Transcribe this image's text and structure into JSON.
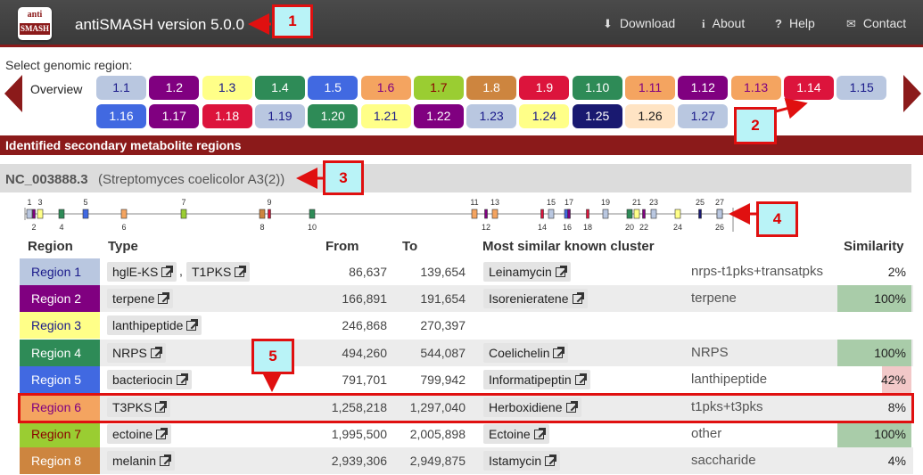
{
  "header": {
    "logo_top": "anti",
    "logo_bottom": "SMASH",
    "title": "antiSMASH version 5.0.0",
    "nav": [
      {
        "label": "Download",
        "icon": "download-icon",
        "glyph": "⬇"
      },
      {
        "label": "About",
        "icon": "info-icon",
        "glyph": "i"
      },
      {
        "label": "Help",
        "icon": "help-icon",
        "glyph": "?"
      },
      {
        "label": "Contact",
        "icon": "mail-icon",
        "glyph": "✉"
      }
    ]
  },
  "callouts": [
    "1",
    "2",
    "3",
    "4",
    "5"
  ],
  "selector": {
    "label": "Select genomic region:",
    "overview": "Overview",
    "regions": [
      {
        "label": "1.1",
        "bg": "#b9c7e0",
        "fg": "#1a1a8a"
      },
      {
        "label": "1.2",
        "bg": "#800080",
        "fg": "#ffffff"
      },
      {
        "label": "1.3",
        "bg": "#ffff88",
        "fg": "#1a1a8a"
      },
      {
        "label": "1.4",
        "bg": "#2e8b57",
        "fg": "#ffffff"
      },
      {
        "label": "1.5",
        "bg": "#4169e1",
        "fg": "#ffffff"
      },
      {
        "label": "1.6",
        "bg": "#f4a460",
        "fg": "#800080"
      },
      {
        "label": "1.7",
        "bg": "#9acd32",
        "fg": "#8b0000"
      },
      {
        "label": "1.8",
        "bg": "#cd853f",
        "fg": "#ffffff"
      },
      {
        "label": "1.9",
        "bg": "#dc143c",
        "fg": "#ffffff"
      },
      {
        "label": "1.10",
        "bg": "#2e8b57",
        "fg": "#ffffff"
      },
      {
        "label": "1.11",
        "bg": "#f4a460",
        "fg": "#800080"
      },
      {
        "label": "1.12",
        "bg": "#800080",
        "fg": "#ffffff"
      },
      {
        "label": "1.13",
        "bg": "#f4a460",
        "fg": "#800080"
      },
      {
        "label": "1.14",
        "bg": "#dc143c",
        "fg": "#ffffff"
      },
      {
        "label": "1.15",
        "bg": "#b9c7e0",
        "fg": "#1a1a8a"
      },
      {
        "label": "1.16",
        "bg": "#4169e1",
        "fg": "#ffffff"
      },
      {
        "label": "1.17",
        "bg": "#800080",
        "fg": "#ffffff"
      },
      {
        "label": "1.18",
        "bg": "#dc143c",
        "fg": "#ffffff"
      },
      {
        "label": "1.19",
        "bg": "#b9c7e0",
        "fg": "#1a1a8a"
      },
      {
        "label": "1.20",
        "bg": "#2e8b57",
        "fg": "#ffffff"
      },
      {
        "label": "1.21",
        "bg": "#ffff88",
        "fg": "#1a1a8a"
      },
      {
        "label": "1.22",
        "bg": "#800080",
        "fg": "#ffffff"
      },
      {
        "label": "1.23",
        "bg": "#b9c7e0",
        "fg": "#1a1a8a"
      },
      {
        "label": "1.24",
        "bg": "#ffff88",
        "fg": "#1a1a8a"
      },
      {
        "label": "1.25",
        "bg": "#191970",
        "fg": "#ffffff"
      },
      {
        "label": "1.26",
        "bg": "#ffe4c4",
        "fg": "#1a1a1a"
      },
      {
        "label": "1.27",
        "bg": "#b9c7e0",
        "fg": "#1a1a8a"
      }
    ]
  },
  "section": {
    "title": "Identified secondary metabolite regions"
  },
  "record": {
    "id": "NC_003888.3",
    "description": "(Streptomyces coelicolor A3(2))"
  },
  "genome": {
    "markers": [
      {
        "n": "1",
        "above": true,
        "fill": "#b9c7e0"
      },
      {
        "n": "2",
        "above": false,
        "fill": "#800080"
      },
      {
        "n": "3",
        "above": true,
        "fill": "#ffff88"
      },
      {
        "n": "4",
        "above": false,
        "fill": "#2e8b57"
      },
      {
        "n": "5",
        "above": true,
        "fill": "#4169e1"
      },
      {
        "n": "6",
        "above": false,
        "fill": "#f4a460"
      },
      {
        "n": "7",
        "above": true,
        "fill": "#9acd32"
      },
      {
        "n": "8",
        "above": false,
        "fill": "#cd853f"
      },
      {
        "n": "9",
        "above": true,
        "fill": "#dc143c"
      },
      {
        "n": "10",
        "above": false,
        "fill": "#2e8b57"
      },
      {
        "n": "11",
        "above": true,
        "fill": "#f4a460"
      },
      {
        "n": "12",
        "above": false,
        "fill": "#800080"
      },
      {
        "n": "13",
        "above": true,
        "fill": "#f4a460"
      },
      {
        "n": "14",
        "above": false,
        "fill": "#dc143c"
      },
      {
        "n": "15",
        "above": true,
        "fill": "#b9c7e0"
      },
      {
        "n": "16",
        "above": false,
        "fill": "#4169e1"
      },
      {
        "n": "17",
        "above": true,
        "fill": "#800080"
      },
      {
        "n": "18",
        "above": false,
        "fill": "#dc143c"
      },
      {
        "n": "19",
        "above": true,
        "fill": "#b9c7e0"
      },
      {
        "n": "20",
        "above": false,
        "fill": "#2e8b57"
      },
      {
        "n": "21",
        "above": true,
        "fill": "#ffff88"
      },
      {
        "n": "22",
        "above": false,
        "fill": "#800080"
      },
      {
        "n": "23",
        "above": true,
        "fill": "#b9c7e0"
      },
      {
        "n": "24",
        "above": false,
        "fill": "#ffff88"
      },
      {
        "n": "25",
        "above": true,
        "fill": "#191970"
      },
      {
        "n": "26",
        "above": false,
        "fill": "#ffe4c4"
      },
      {
        "n": "27",
        "above": true,
        "fill": "#b9c7e0"
      }
    ]
  },
  "table": {
    "headers": {
      "region": "Region",
      "type": "Type",
      "from": "From",
      "to": "To",
      "most_similar": "Most similar known cluster",
      "similarity": "Similarity"
    },
    "rows": [
      {
        "region": "Region 1",
        "bg": "#b9c7e0",
        "fg": "#1a1a8a",
        "types": [
          "hglE-KS",
          "T1PKS"
        ],
        "from": "86,637",
        "to": "139,654",
        "cluster": "Leinamycin",
        "cluster_type": "nrps-t1pks+transatpks",
        "similarity": "2%",
        "sim_bg": "transparent"
      },
      {
        "region": "Region 2",
        "bg": "#800080",
        "fg": "#ffffff",
        "types": [
          "terpene"
        ],
        "from": "166,891",
        "to": "191,654",
        "cluster": "Isorenieratene",
        "cluster_type": "terpene",
        "similarity": "100%",
        "sim_bg": "#a9cca9"
      },
      {
        "region": "Region 3",
        "bg": "#ffff88",
        "fg": "#1a1a8a",
        "types": [
          "lanthipeptide"
        ],
        "from": "246,868",
        "to": "270,397",
        "cluster": "",
        "cluster_type": "",
        "similarity": "",
        "sim_bg": "transparent"
      },
      {
        "region": "Region 4",
        "bg": "#2e8b57",
        "fg": "#ffffff",
        "types": [
          "NRPS"
        ],
        "from": "494,260",
        "to": "544,087",
        "cluster": "Coelichelin",
        "cluster_type": "NRPS",
        "similarity": "100%",
        "sim_bg": "#a9cca9"
      },
      {
        "region": "Region 5",
        "bg": "#4169e1",
        "fg": "#ffffff",
        "types": [
          "bacteriocin"
        ],
        "from": "791,701",
        "to": "799,942",
        "cluster": "Informatipeptin",
        "cluster_type": "lanthipeptide",
        "similarity": "42%",
        "sim_bg": "#f2c8c8"
      },
      {
        "region": "Region 6",
        "bg": "#f4a460",
        "fg": "#800080",
        "types": [
          "T3PKS"
        ],
        "from": "1,258,218",
        "to": "1,297,040",
        "cluster": "Herboxidiene",
        "cluster_type": "t1pks+t3pks",
        "similarity": "8%",
        "sim_bg": "transparent"
      },
      {
        "region": "Region 7",
        "bg": "#9acd32",
        "fg": "#8b0000",
        "types": [
          "ectoine"
        ],
        "from": "1,995,500",
        "to": "2,005,898",
        "cluster": "Ectoine",
        "cluster_type": "other",
        "similarity": "100%",
        "sim_bg": "#a9cca9"
      },
      {
        "region": "Region 8",
        "bg": "#cd853f",
        "fg": "#ffffff",
        "types": [
          "melanin"
        ],
        "from": "2,939,306",
        "to": "2,949,875",
        "cluster": "Istamycin",
        "cluster_type": "saccharide",
        "similarity": "4%",
        "sim_bg": "transparent"
      }
    ]
  }
}
